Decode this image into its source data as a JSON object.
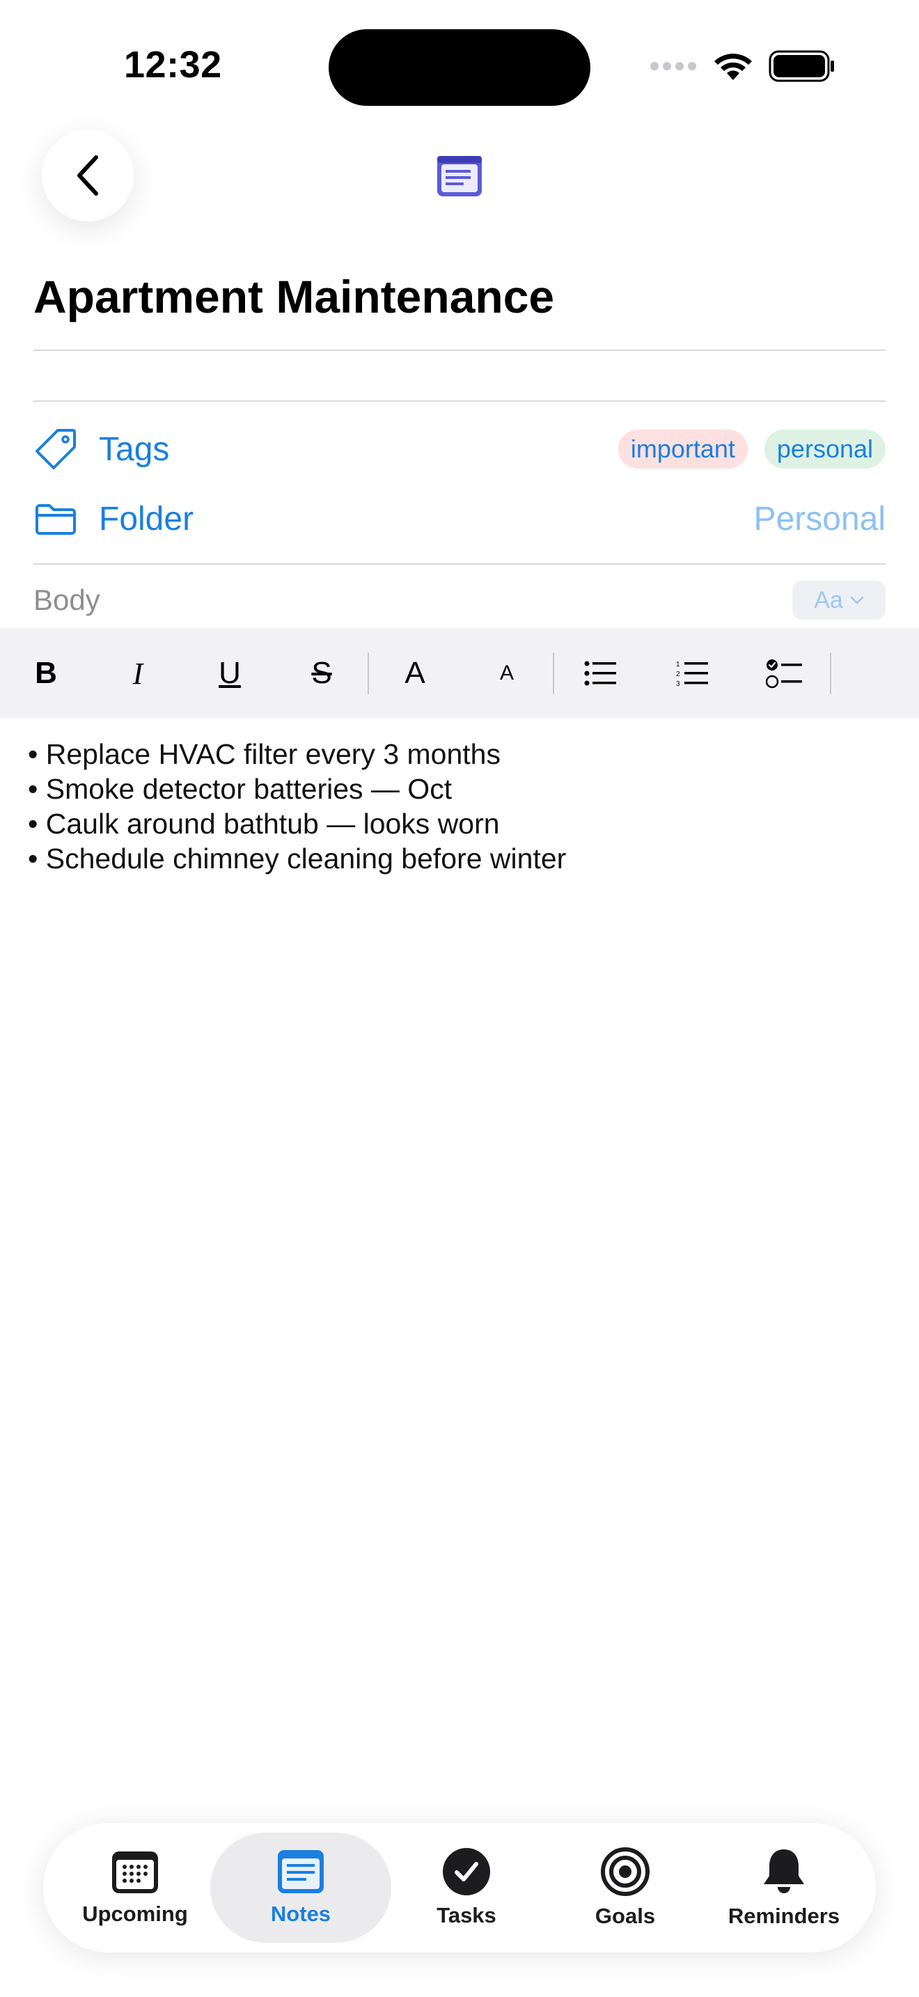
{
  "status": {
    "time": "12:32"
  },
  "note": {
    "title": "Apartment Maintenance",
    "tags_label": "Tags",
    "tags": [
      "important",
      "personal"
    ],
    "folder_label": "Folder",
    "folder_value": "Personal",
    "body_label": "Body",
    "font_button": "Aa",
    "body_lines": [
      "• Replace HVAC filter every 3 months",
      "• Smoke detector batteries — Oct",
      "• Caulk around bathtub — looks worn",
      "• Schedule chimney cleaning before winter"
    ]
  },
  "toolbar": {
    "bold": "B",
    "italic": "I",
    "underline": "U",
    "strike": "S",
    "font_large": "A",
    "font_small": "A"
  },
  "tabs": [
    {
      "label": "Upcoming",
      "icon": "calendar-icon"
    },
    {
      "label": "Notes",
      "icon": "note-icon",
      "active": true
    },
    {
      "label": "Tasks",
      "icon": "checkmark-circle-icon"
    },
    {
      "label": "Goals",
      "icon": "target-icon"
    },
    {
      "label": "Reminders",
      "icon": "bell-icon"
    }
  ],
  "colors": {
    "accent": "#1a7fe0",
    "note_icon": "#5b5bd6"
  }
}
